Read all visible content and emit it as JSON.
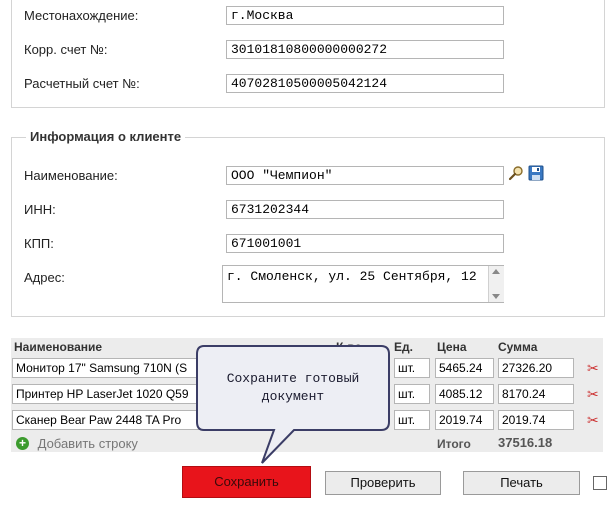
{
  "bank": {
    "location_label": "Местонахождение:",
    "location_value": "г.Москва",
    "corr_label": "Корр. счет №:",
    "corr_value": "30101810800000000272",
    "account_label": "Расчетный счет №:",
    "account_value": "40702810500005042124"
  },
  "client": {
    "legend": "Информация о клиенте",
    "name_label": "Наименование:",
    "name_value": "ООО \"Чемпион\"",
    "inn_label": "ИНН:",
    "inn_value": "6731202344",
    "kpp_label": "КПП:",
    "kpp_value": "671001001",
    "address_label": "Адрес:",
    "address_value": "г. Смоленск, ул. 25 Сентября, 12"
  },
  "table": {
    "headers": {
      "name": "Наименование",
      "qty": "К-во",
      "unit": "Ед.",
      "price": "Цена",
      "sum": "Сумма"
    },
    "rows": [
      {
        "name": "Монитор 17\" Samsung 710N (S",
        "unit": "шт.",
        "price": "5465.24",
        "sum": "27326.20"
      },
      {
        "name": "Принтер HP LaserJet 1020 Q59",
        "unit": "шт.",
        "price": "4085.12",
        "sum": "8170.24"
      },
      {
        "name": "Сканер Bear Paw 2448 TA Pro",
        "unit": "шт.",
        "price": "2019.74",
        "sum": "2019.74"
      }
    ],
    "add_row": "Добавить строку",
    "total_label": "Итого",
    "total_value": "37516.18"
  },
  "tooltip": {
    "text_line1": "Сохраните готовый",
    "text_line2": "документ"
  },
  "buttons": {
    "save": "Сохранить",
    "check": "Проверить",
    "print": "Печать"
  },
  "colors": {
    "save_button": "#e8141b",
    "tooltip_bg": "#edeef4",
    "tooltip_border": "#3b3d66"
  }
}
